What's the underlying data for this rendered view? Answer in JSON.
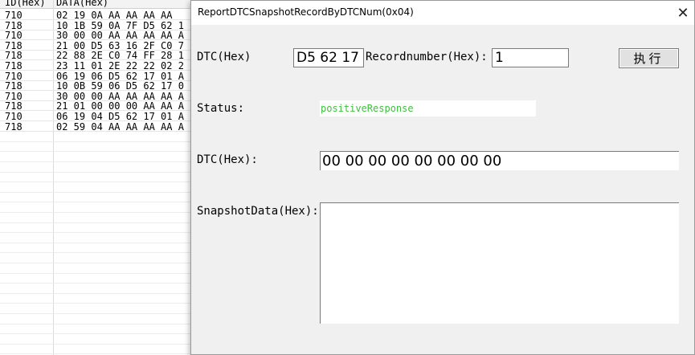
{
  "background_table": {
    "headers": [
      "ID(Hex)",
      "DATA(Hex)"
    ],
    "rows": [
      {
        "id": "710",
        "data": "02 19 0A AA AA AA AA"
      },
      {
        "id": "718",
        "data": "10 1B 59 0A 7F D5 62 1"
      },
      {
        "id": "710",
        "data": "30 00 00 AA AA AA AA A"
      },
      {
        "id": "718",
        "data": "21 00 D5 63 16 2F C0 7"
      },
      {
        "id": "718",
        "data": "22 88 2E C0 74 FF 28 1"
      },
      {
        "id": "718",
        "data": "23 11 01 2E 22 22 02 2"
      },
      {
        "id": "710",
        "data": "06 19 06 D5 62 17 01 A"
      },
      {
        "id": "718",
        "data": "10 0B 59 06 D5 62 17 0"
      },
      {
        "id": "710",
        "data": "30 00 00 AA AA AA AA A"
      },
      {
        "id": "718",
        "data": "21 01 00 00 00 AA AA A"
      },
      {
        "id": "710",
        "data": "06 19 04 D5 62 17 01 A"
      },
      {
        "id": "718",
        "data": "02 59 04 AA AA AA AA A"
      }
    ]
  },
  "dialog": {
    "title": "ReportDTCSnapshotRecordByDTCNum(0x04)",
    "close_glyph": "✕",
    "dtc_input_label": "DTC(Hex)",
    "dtc_input_value": "D5 62 17",
    "recordnumber_label": "Recordnumber(Hex):",
    "recordnumber_value": "1",
    "execute_label": "执行",
    "status_label": "Status:",
    "status_value": "positiveResponse",
    "dtc_output_label": "DTC(Hex):",
    "dtc_output_value": "00 00 00 00 00 00 00 00",
    "snapshot_label": "SnapshotData(Hex):",
    "snapshot_value": ""
  },
  "colors": {
    "status_text": "#3fbf3f",
    "dialog_bg": "#f0f0f0"
  }
}
